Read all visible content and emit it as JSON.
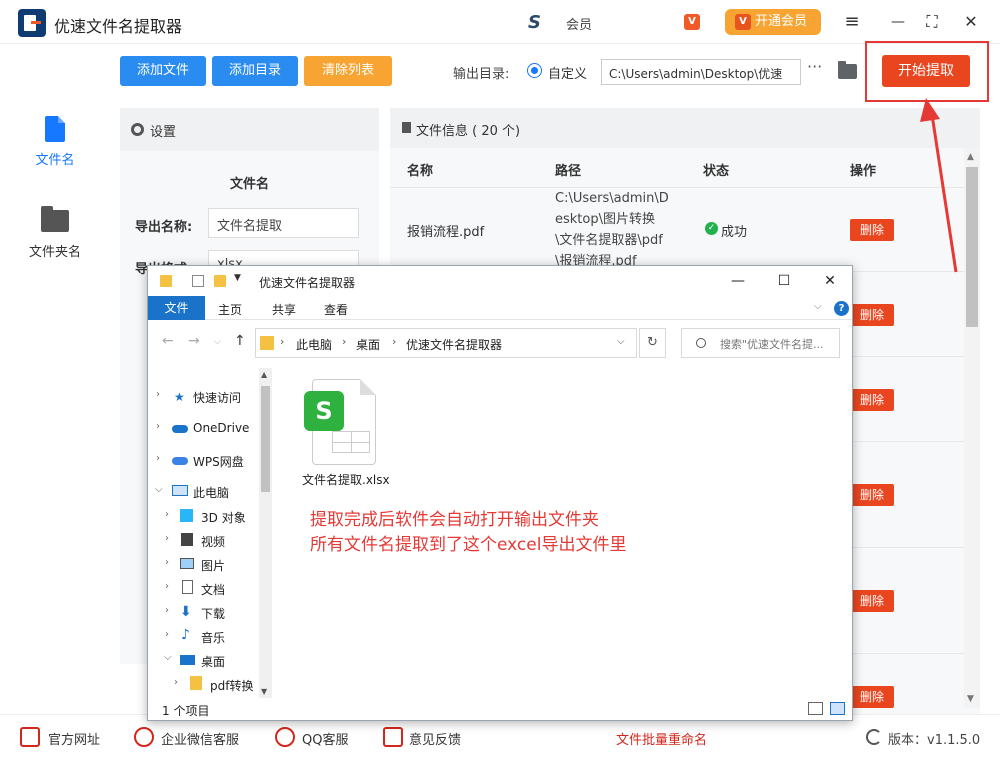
{
  "app": {
    "title": "优速文件名提取器",
    "user_text": "会员",
    "small_badge": "V",
    "vip_button_label": "开通会员",
    "vip_icon": "V"
  },
  "window_controls": {
    "menu": "≡",
    "minimize": "—",
    "maximize": "⛶",
    "close": "✕"
  },
  "toolbar": {
    "add_file": "添加文件",
    "add_dir": "添加目录",
    "clear_list": "清除列表",
    "output_label": "输出目录:",
    "custom_label": "自定义",
    "path_value": "C:\\Users\\admin\\Desktop\\优速",
    "more": "···",
    "start_label": "开始提取"
  },
  "nav": {
    "items": [
      {
        "label": "文件名"
      },
      {
        "label": "文件夹名"
      }
    ]
  },
  "settings": {
    "header": "设置",
    "section": "文件名",
    "export_name_label": "导出名称:",
    "export_name_value": "文件名提取",
    "export_format_label": "导出格式:",
    "export_format_value": "xlsx"
  },
  "fileinfo": {
    "header": "文件信息 ( 20 个)",
    "columns": [
      "名称",
      "路径",
      "状态",
      "操作"
    ],
    "row": {
      "name": "报销流程.pdf",
      "path": "C:\\Users\\admin\\Desktop\\图片转换\\文件名提取器\\pdf\\报销流程.pdf",
      "status": "成功"
    },
    "delete_label": "删除"
  },
  "bottom": {
    "items": [
      "官方网址",
      "企业微信客服",
      "QQ客服",
      "意见反馈"
    ],
    "rename_link": "文件批量重命名",
    "version": "版本：v1.1.5.0"
  },
  "explorer": {
    "title": "优速文件名提取器",
    "menu": [
      "文件",
      "主页",
      "共享",
      "查看"
    ],
    "breadcrumb": [
      "此电脑",
      "桌面",
      "优速文件名提取器"
    ],
    "search_placeholder": "搜索\"优速文件名提...",
    "tree": [
      {
        "label": "快速访问",
        "level": 0,
        "icon": "star-icon"
      },
      {
        "label": "OneDrive",
        "level": 0,
        "icon": "cloud-icon"
      },
      {
        "label": "WPS网盘",
        "level": 0,
        "icon": "cloud-icon"
      },
      {
        "label": "此电脑",
        "level": 0,
        "icon": "computer-icon"
      },
      {
        "label": "3D 对象",
        "level": 1,
        "icon": "cube-icon"
      },
      {
        "label": "视频",
        "level": 1,
        "icon": "video-icon"
      },
      {
        "label": "图片",
        "level": 1,
        "icon": "picture-icon"
      },
      {
        "label": "文档",
        "level": 1,
        "icon": "document-icon"
      },
      {
        "label": "下载",
        "level": 1,
        "icon": "download-icon"
      },
      {
        "label": "音乐",
        "level": 1,
        "icon": "music-icon"
      },
      {
        "label": "桌面",
        "level": 1,
        "icon": "desktop-icon"
      },
      {
        "label": "pdf转换",
        "level": 2,
        "icon": "folder-icon"
      }
    ],
    "file_badge": "S",
    "file_name": "文件名提取.xlsx",
    "annotation_line1": "提取完成后软件会自动打开输出文件夹",
    "annotation_line2": "所有文件名提取到了这个excel导出文件里",
    "status_text": "1 个项目"
  },
  "colors": {
    "primary": "#1677ff",
    "orange": "#f7a432",
    "danger": "#e9451f",
    "annotation": "#e53935",
    "success": "#23b14d"
  }
}
